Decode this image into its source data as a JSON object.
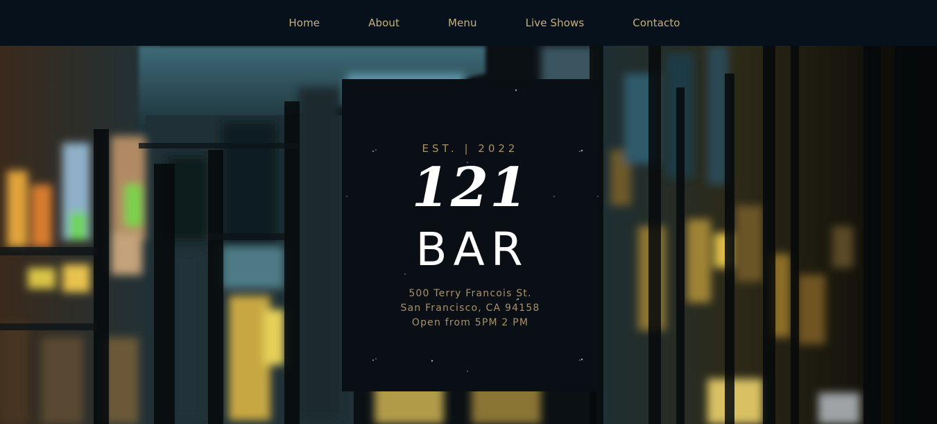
{
  "nav": {
    "items": [
      {
        "label": "Home"
      },
      {
        "label": "About"
      },
      {
        "label": "Menu"
      },
      {
        "label": "Live Shows"
      },
      {
        "label": "Contacto"
      }
    ]
  },
  "card": {
    "est": "EST. | 2022",
    "number": "121",
    "word": "BAR",
    "address_line1": "500 Terry Francois St.",
    "address_line2": "San Francisco, CA 94158",
    "hours": "Open from 5PM 2 PM"
  },
  "colors": {
    "nav_background": "#06111b",
    "nav_text": "#c8b27d",
    "card_background": "#0a0f16",
    "accent_gold": "#a99168",
    "headline_white": "#ffffff"
  },
  "hero": {
    "background_image": "blurred night street with bar windows and lights"
  }
}
